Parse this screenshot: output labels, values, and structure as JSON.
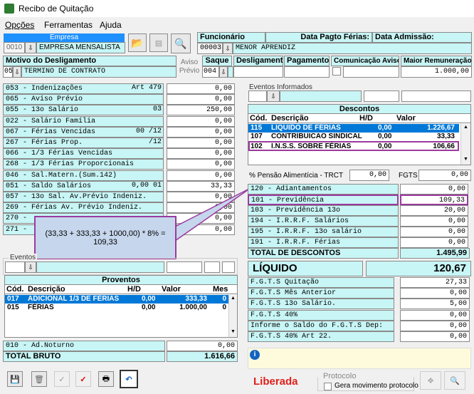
{
  "window": {
    "title": "Recibo de Quitação"
  },
  "menu": [
    "Opções",
    "Ferramentas",
    "Ajuda"
  ],
  "empresa": {
    "label": "Empresa",
    "code": "0010",
    "name": "EMPRESA MENSALISTA"
  },
  "header": {
    "funcionario_label": "Funcionário",
    "funcionario_code": "00003",
    "funcionario_name": "MENOR APRENDIZ",
    "data_pagto_label": "Data Pagto Férias:",
    "data_admissao_label": "Data Admissão:"
  },
  "desligamento": {
    "motivo_label": "Motivo do Desligamento",
    "motivo_code": "05",
    "motivo_name": "TERMINO DE CONTRATO",
    "aviso_label": "Aviso Prévio",
    "saque_label": "Saque",
    "saque_value": "004",
    "deslig_label": "Desligamento",
    "pagamento_label": "Pagamento",
    "comunicacao_label": "Comunicação Aviso",
    "maior_label": "Maior Remuneração",
    "maior_value": "1.000,00"
  },
  "left_rows": [
    {
      "label": "053 - Indenizações",
      "extra": "Art 479",
      "value": "0,00"
    },
    {
      "label": "065 - Aviso Prévio",
      "value": "0,00"
    },
    {
      "label": "055 - 13o Salário",
      "extra": "03",
      "value": "250,00"
    },
    {
      "label": "022 - Salário Família",
      "value": "0,00"
    },
    {
      "label": "067 - Férias Vencidas",
      "extra": "00 /12",
      "value": "0,00"
    },
    {
      "label": "267 - Férias Prop.",
      "extra": "/12",
      "value": "0,00"
    },
    {
      "label": "066 - 1/3 Férias Vencidas",
      "value": "0,00"
    },
    {
      "label": "268 - 1/3 Férias Proporcionais",
      "value": "0,00"
    },
    {
      "label": "046 - Sal.Matern.(Sum.142)",
      "value": "0,00"
    },
    {
      "label": "051 - Saldo Salários",
      "extra": "0,00 01",
      "value": "33,33"
    },
    {
      "label": "057 - 13o Sal. Av.Prévio Indeniz.",
      "value": "0,00"
    },
    {
      "label": "269 - Férias Av. Prévio Indeniz.",
      "value": "0,00"
    },
    {
      "label": "270 -",
      "value": "0,00"
    },
    {
      "label": "271 -",
      "value": "0,00"
    }
  ],
  "callout": {
    "text": "(33,33 + 333,33 + 1000,00) * 8% = 109,33"
  },
  "eventos_label": "Eventos",
  "proventos": {
    "title": "Proventos",
    "cols": [
      "Cód.",
      "Descrição",
      "H/D",
      "Valor",
      "Mes"
    ],
    "rows": [
      {
        "cod": "017",
        "desc": "ADICIONAL 1/3 DE FÉRIAS",
        "hd": "0,00",
        "valor": "333,33",
        "mes": "0"
      },
      {
        "cod": "015",
        "desc": "FÉRIAS",
        "hd": "0,00",
        "valor": "1.000,00",
        "mes": "0"
      }
    ]
  },
  "adnoturno": {
    "label": "010 - Ad.Noturno",
    "value": "0,00"
  },
  "total_bruto": {
    "label": "TOTAL BRUTO",
    "value": "1.616,66"
  },
  "eventos_informados_label": "Eventos Informados",
  "descontos": {
    "title": "Descontos",
    "cols": [
      "Cód.",
      "Descrição",
      "H/D",
      "Valor"
    ],
    "rows": [
      {
        "cod": "115",
        "desc": "LIQUIDO DE FÉRIAS",
        "hd": "0,00",
        "valor": "1.226,67"
      },
      {
        "cod": "107",
        "desc": "CONTRIBUICAO SINDICAL",
        "hd": "0,00",
        "valor": "33,33"
      },
      {
        "cod": "102",
        "desc": "I.N.S.S. SOBRE FÉRIAS",
        "hd": "0,00",
        "valor": "106,66"
      }
    ]
  },
  "pensao": {
    "label": "% Pensão Alimentícia - TRCT",
    "value": "0,00",
    "fgts_label": "FGTS",
    "fgts_value": "0,00"
  },
  "right_rows": [
    {
      "label": "120 - Adiantamentos",
      "value": "0,00"
    },
    {
      "label": "101 - Previdência",
      "value": "109,33"
    },
    {
      "label": "103 - Previdência 13o",
      "value": "20,00"
    },
    {
      "label": "194 - I.R.R.F. Salários",
      "value": "0,00"
    },
    {
      "label": "195 - I.R.R.F. 13o salário",
      "value": "0,00"
    },
    {
      "label": "191 - I.R.R.F. Férias",
      "value": "0,00"
    }
  ],
  "total_descontos": {
    "label": "TOTAL DE DESCONTOS",
    "value": "1.495,99"
  },
  "liquido": {
    "label": "LÍQUIDO",
    "value": "120,67"
  },
  "fgts_rows": [
    {
      "label": "F.G.T.S Quitação",
      "value": "27,33"
    },
    {
      "label": "F.G.T.S Mês Anterior",
      "value": "0,00"
    },
    {
      "label": "F.G.T.S 13o Salário.",
      "value": "5,00"
    },
    {
      "label": "F.G.T.S 40%",
      "value": "0,00"
    },
    {
      "label": "Informe o Saldo do F.G.T.S Dep:",
      "value": "0,00"
    },
    {
      "label": "F.G.T.S 40% Art 22.",
      "value": "0,00"
    }
  ],
  "status": {
    "liberada": "Liberada",
    "protocolo_label": "Protocolo",
    "gera_label": "Gera movimento protocolo"
  },
  "colors": {
    "highlight": "#0078d7",
    "outline": "#9b3a9e",
    "liberada": "#e0201c",
    "cyan": "#c8f5f5"
  }
}
